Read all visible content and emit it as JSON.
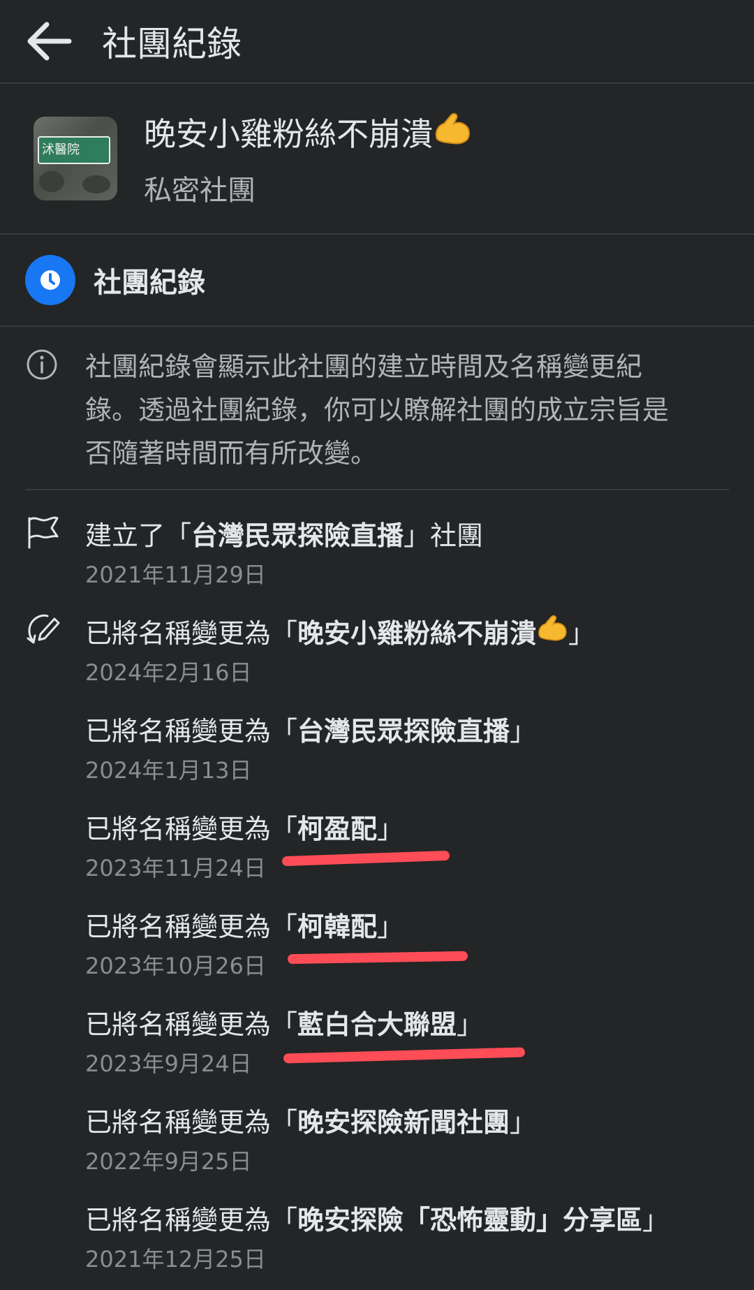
{
  "header": {
    "title": "社團紀錄"
  },
  "group": {
    "name": "晚安小雞粉絲不崩潰",
    "type": "私密社團",
    "avatar_sign_text": "沭醫院"
  },
  "section": {
    "label": "社團紀錄"
  },
  "info": {
    "text": "社團紀錄會顯示此社團的建立時間及名稱變更紀錄。透過社團紀錄，你可以瞭解社團的成立宗旨是否隨著時間而有所改變。"
  },
  "entries": [
    {
      "prefix": "建立了「",
      "name": "台灣民眾探險直播",
      "suffix": "」社團",
      "date": "2021年11月29日",
      "icon": "flag-icon"
    },
    {
      "prefix": "已將名稱變更為「",
      "name": "晚安小雞粉絲不崩潰",
      "suffix": " 」",
      "date": "2024年2月16日",
      "icon": "rename-icon"
    },
    {
      "prefix": "已將名稱變更為「",
      "name": "台灣民眾探險直播",
      "suffix": "」",
      "date": "2024年1月13日"
    },
    {
      "prefix": "已將名稱變更為「",
      "name": "柯盈配",
      "suffix": "」",
      "date": "2023年11月24日"
    },
    {
      "prefix": "已將名稱變更為「",
      "name": "柯韓配",
      "suffix": "」",
      "date": "2023年10月26日"
    },
    {
      "prefix": "已將名稱變更為「",
      "name": "藍白合大聯盟",
      "suffix": "」",
      "date": "2023年9月24日"
    },
    {
      "prefix": "已將名稱變更為「",
      "name": "晚安探險新聞社團",
      "suffix": "」",
      "date": "2022年9月25日"
    },
    {
      "prefix": "已將名稱變更為「",
      "name": "晚安探險「恐怖靈動」分享區",
      "suffix": "」",
      "date": "2021年12月25日"
    }
  ],
  "colors": {
    "background": "#242526",
    "accent": "#1877f2",
    "annotation": "#ff4d57"
  }
}
